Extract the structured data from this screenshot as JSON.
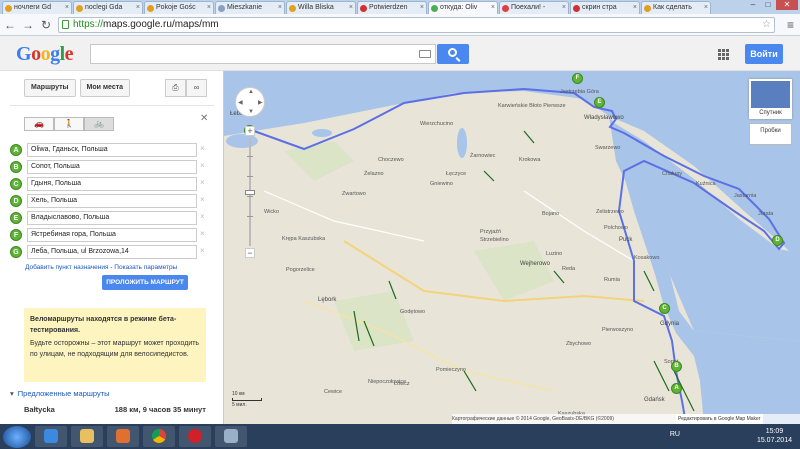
{
  "browser": {
    "tabs": [
      {
        "label": "ночлеги Gd",
        "active": false
      },
      {
        "label": "noclegi Gda",
        "active": false
      },
      {
        "label": "Pokoje Gośc",
        "active": false
      },
      {
        "label": "Mieszkanie",
        "active": false
      },
      {
        "label": "Willa Bliska",
        "active": false
      },
      {
        "label": "Potwierdzen",
        "active": false
      },
      {
        "label": "откуда: Oliv",
        "active": true
      },
      {
        "label": "Поехали! -",
        "active": false
      },
      {
        "label": "скрин стра",
        "active": false
      },
      {
        "label": "Как сделать",
        "active": false
      }
    ],
    "url_scheme": "https://",
    "url_rest": "maps.google.ru/maps/mm"
  },
  "header": {
    "logo": "Google",
    "signin_label": "Войти"
  },
  "panel": {
    "routes_btn": "Маршруты",
    "myplaces_btn": "Мои места",
    "waypoints": [
      {
        "letter": "A",
        "value": "Oliwa, Гданьск, Польша"
      },
      {
        "letter": "B",
        "value": "Сопот, Польша"
      },
      {
        "letter": "C",
        "value": "Гдыня, Польша"
      },
      {
        "letter": "D",
        "value": "Хель, Польша"
      },
      {
        "letter": "E",
        "value": "Владыславово, Польша"
      },
      {
        "letter": "F",
        "value": "Ястребиная гора, Польша"
      },
      {
        "letter": "G",
        "value": "Леба, Польша, ul Brzozowa,14"
      }
    ],
    "add_dest": "Добавить пункт назначения",
    "sep": " - ",
    "show_params": "Показать параметры",
    "route_btn": "ПРОЛОЖИТЬ МАРШРУТ",
    "warning_title": "Веломаршруты находятся в режиме бета-тестирования.",
    "warning_body": "Будьте осторожны – этот маршрут может проходить по улицам, не подходящим для велосипедистов.",
    "suggested": "Предложенные маршруты",
    "route_name": "Bałtycka",
    "route_info": "188 км, 9 часов 35 минут"
  },
  "map": {
    "sat_label": "Спутник",
    "traffic_label": "Пробки",
    "scale_km": "10 км",
    "scale_mi": "5 мил.",
    "attrib": "Картографические данные © 2014 Google, GeoBasis-DE/BKG (©2009)",
    "maker": "Редактировать в Google Map Maker",
    "labels": [
      {
        "t": "Łeba",
        "c": "big"
      },
      {
        "t": "Władysławowo",
        "c": "big"
      },
      {
        "t": "Jastrzębia Góra",
        "c": ""
      },
      {
        "t": "Karwieńskie Błoto Pierwsze",
        "c": ""
      },
      {
        "t": "Wierzchucino",
        "c": ""
      },
      {
        "t": "Żarnowiec",
        "c": ""
      },
      {
        "t": "Choczewo",
        "c": ""
      },
      {
        "t": "Żelazno",
        "c": ""
      },
      {
        "t": "Łęczyce",
        "c": ""
      },
      {
        "t": "Gniewino",
        "c": ""
      },
      {
        "t": "Krokowa",
        "c": ""
      },
      {
        "t": "Puck",
        "c": "big"
      },
      {
        "t": "Swarzewo",
        "c": ""
      },
      {
        "t": "Chałupy",
        "c": ""
      },
      {
        "t": "Kuźnica",
        "c": ""
      },
      {
        "t": "Jastarnia",
        "c": ""
      },
      {
        "t": "Jurata",
        "c": ""
      },
      {
        "t": "Wejherowo",
        "c": "big"
      },
      {
        "t": "Reda",
        "c": ""
      },
      {
        "t": "Rumia",
        "c": ""
      },
      {
        "t": "Kosakowo",
        "c": ""
      },
      {
        "t": "Gdynia",
        "c": "big"
      },
      {
        "t": "Sopot",
        "c": ""
      },
      {
        "t": "Gdańsk",
        "c": "big"
      },
      {
        "t": "Lębork",
        "c": "big"
      },
      {
        "t": "Wicko",
        "c": ""
      },
      {
        "t": "Łeba",
        "c": ""
      },
      {
        "t": "Nowa Wieś Lęborska",
        "c": ""
      },
      {
        "t": "Cewice",
        "c": ""
      },
      {
        "t": "Łęczyce",
        "c": ""
      },
      {
        "t": "Linia",
        "c": ""
      },
      {
        "t": "Szemud",
        "c": ""
      },
      {
        "t": "Kartuzy",
        "c": ""
      },
      {
        "t": "Żukowo",
        "c": ""
      },
      {
        "t": "Przodkowo",
        "c": ""
      },
      {
        "t": "Somonino",
        "c": ""
      },
      {
        "t": "Sierakowice",
        "c": ""
      },
      {
        "t": "Chmielno",
        "c": ""
      },
      {
        "t": "Potęgowo",
        "c": ""
      },
      {
        "t": "Czarna Dąbrówka",
        "c": ""
      },
      {
        "t": "Godętowo",
        "c": ""
      },
      {
        "t": "Zwartowo",
        "c": ""
      },
      {
        "t": "Krępa Kaszubska",
        "c": ""
      },
      {
        "t": "Pogorzelice",
        "c": ""
      },
      {
        "t": "Wicko",
        "c": ""
      },
      {
        "t": "Kębłowo",
        "c": ""
      },
      {
        "t": "Łebno",
        "c": ""
      },
      {
        "t": "Kamień",
        "c": ""
      },
      {
        "t": "Strzepcz",
        "c": ""
      },
      {
        "t": "Mirachowo",
        "c": ""
      },
      {
        "t": "Niepoczołowice",
        "c": ""
      },
      {
        "t": "Pomieczyno",
        "c": ""
      },
      {
        "t": "Przyjaźń",
        "c": ""
      },
      {
        "t": "Bojano",
        "c": ""
      },
      {
        "t": "Luzino",
        "c": ""
      },
      {
        "t": "Strzebielino",
        "c": ""
      },
      {
        "t": "Łówcz",
        "c": ""
      },
      {
        "t": "Zelistrzewo",
        "c": ""
      },
      {
        "t": "Kaszubska",
        "c": ""
      },
      {
        "t": "Mechelinki",
        "c": ""
      },
      {
        "t": "Pierwoszyno",
        "c": ""
      },
      {
        "t": "Zbychowo",
        "c": ""
      },
      {
        "t": "Polchowo",
        "c": ""
      }
    ],
    "pins": [
      "A",
      "B",
      "C",
      "D",
      "E",
      "F",
      "G"
    ]
  },
  "taskbar": {
    "lang": "RU",
    "time": "15:09",
    "date": "15.07.2014"
  }
}
